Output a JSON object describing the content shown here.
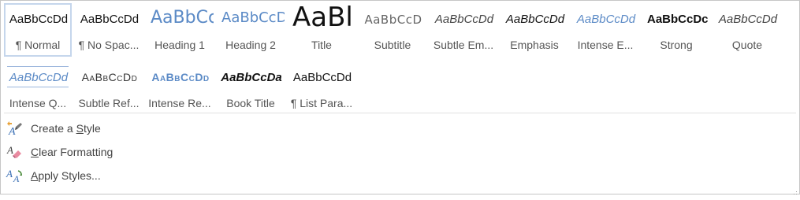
{
  "gallery": {
    "row1": [
      {
        "sample": "AaBbCcDd",
        "label": "¶ Normal",
        "selected": true
      },
      {
        "sample": "AaBbCcDd",
        "label": "¶ No Spac..."
      },
      {
        "sample": "AaBbCc",
        "label": "Heading 1"
      },
      {
        "sample": "AaBbCcD",
        "label": "Heading 2"
      },
      {
        "sample": "AaBl",
        "label": "Title"
      },
      {
        "sample": "AaBbCcD",
        "label": "Subtitle"
      },
      {
        "sample": "AaBbCcDd",
        "label": "Subtle Em..."
      },
      {
        "sample": "AaBbCcDd",
        "label": "Emphasis"
      },
      {
        "sample": "AaBbCcDd",
        "label": "Intense E..."
      },
      {
        "sample": "AaBbCcDc",
        "label": "Strong"
      },
      {
        "sample": "AaBbCcDd",
        "label": "Quote"
      }
    ],
    "row2": [
      {
        "sample": "AaBbCcDd",
        "label": "Intense Q..."
      },
      {
        "sample": "AaBbCcDd",
        "label": "Subtle Ref..."
      },
      {
        "sample": "AaBbCcDd",
        "label": "Intense Re..."
      },
      {
        "sample": "AaBbCcDa",
        "label": "Book Title"
      },
      {
        "sample": "AaBbCcDd",
        "label": "¶ List Para..."
      }
    ]
  },
  "commands": {
    "create": {
      "pre": "Create a ",
      "accel": "S",
      "post": "tyle"
    },
    "clear": {
      "pre": "",
      "accel": "C",
      "post": "lear Formatting"
    },
    "apply": {
      "pre": "",
      "accel": "A",
      "post": "pply Styles..."
    }
  },
  "colors": {
    "accent_blue": "#5b8ac6",
    "selection_border": "#c5d6ec"
  }
}
